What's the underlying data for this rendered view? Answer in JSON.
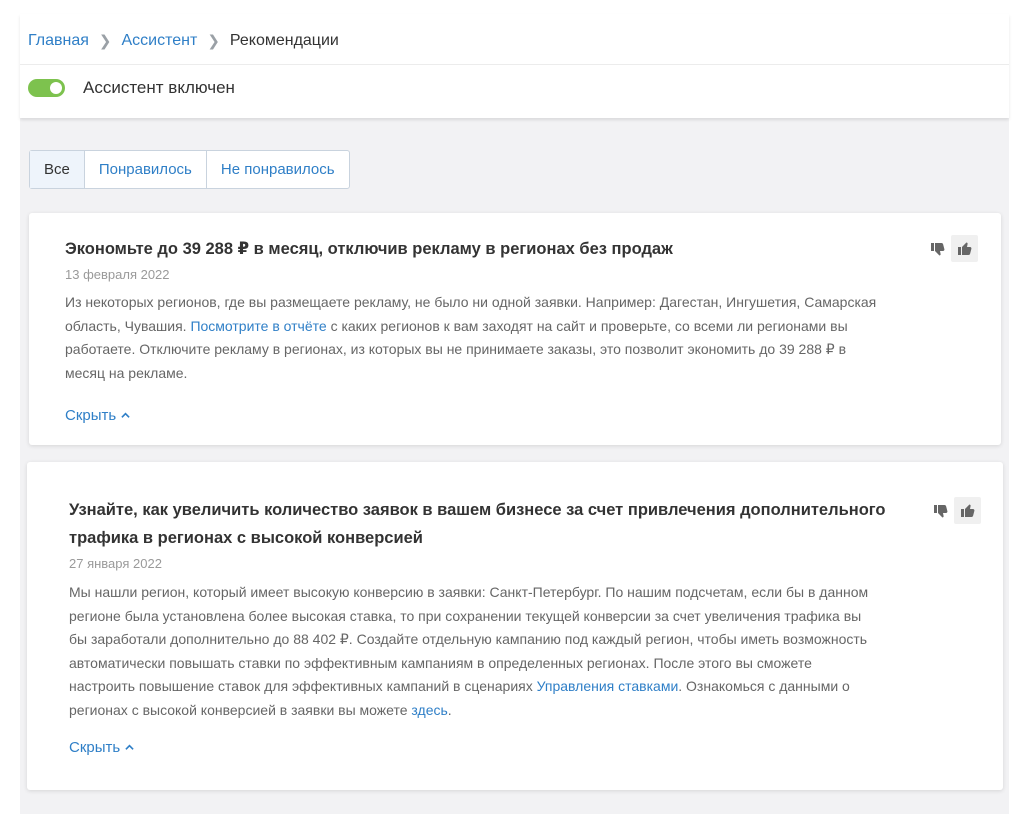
{
  "breadcrumb": {
    "home": "Главная",
    "assistant": "Ассистент",
    "current": "Рекомендации"
  },
  "assistant_toggle": {
    "label": "Ассистент включен",
    "on": true,
    "color": "#7dc24e"
  },
  "filters": {
    "all": "Все",
    "liked": "Понравилось",
    "disliked": "Не понравилось",
    "active": "all"
  },
  "recommendations": [
    {
      "title": "Экономьте до 39 288 ₽ в месяц, отключив рекламу в регионах без продаж",
      "date": "13 февраля 2022",
      "text_1": "Из некоторых регионов, где вы размещаете рекламу, не было ни одной заявки. Например: Дагестан, Ингушетия, Самарская область, Чувашия.",
      "link_1": "Посмотрите в отчёте",
      "text_2": "с каких регионов к вам заходят на сайт и проверьте, со всеми ли регионами вы работаете. Отключите рекламу в регионах, из которых вы не принимаете заказы, это позволит экономить до 39 288 ₽ в месяц на рекламе.",
      "hide_label": "Скрыть"
    },
    {
      "title": "Узнайте, как увеличить количество заявок в вашем бизнесе за счет привлечения дополнительного трафика в регионах с высокой конверсией",
      "date": "27 января 2022",
      "text_1": "Мы нашли регион, который имеет высокую конверсию в заявки: Санкт-Петербург. По нашим подсчетам, если бы в данном регионе была установлена более высокая ставка, то при сохранении текущей конверсии за счет увеличения трафика вы бы заработали дополнительно до 88 402 ₽. Создайте отдельную кампанию под каждый регион, чтобы иметь возможность автоматически повышать ставки по эффективным кампаниям в определенных регионах. После этого вы сможете настроить повышение ставок для эффективных кампаний в сценариях",
      "link_1": "Управления ставками",
      "text_2": ". Ознакомься с данными о регионах с высокой конверсией в заявки вы можете",
      "link_2": "здесь",
      "text_3": ".",
      "hide_label": "Скрыть"
    }
  ],
  "icons": {
    "dislike": "thumbs-down-icon",
    "like": "thumbs-up-icon",
    "hide_chevron": "chevron-up-icon"
  },
  "colors": {
    "link": "#2f7fc7",
    "toggle_on": "#7dc24e",
    "background": "#f2f2f4"
  }
}
